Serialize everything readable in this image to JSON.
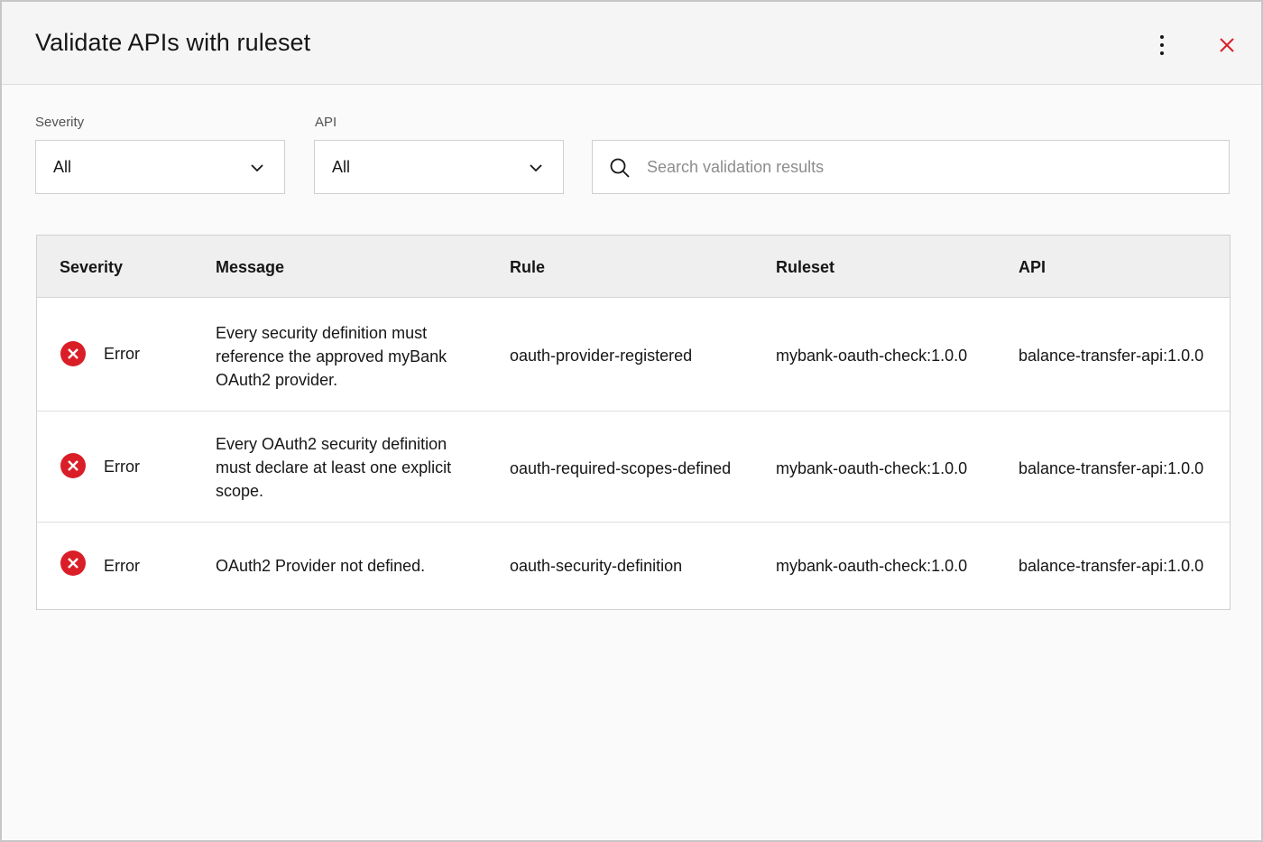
{
  "modal": {
    "title": "Validate APIs with ruleset",
    "close_color": "#da1e28"
  },
  "filters": {
    "severity": {
      "label": "Severity",
      "value": "All"
    },
    "api": {
      "label": "API",
      "value": "All"
    },
    "search": {
      "placeholder": "Search validation results",
      "value": ""
    }
  },
  "table": {
    "columns": [
      "Severity",
      "Message",
      "Rule",
      "Ruleset",
      "API"
    ],
    "rows": [
      {
        "severity": "Error",
        "icon": "error-filled-icon",
        "message": "Every security definition must reference the approved myBank OAuth2 provider.",
        "rule": "oauth-provider-registered",
        "ruleset": "mybank-oauth-check:1.0.0",
        "api": "balance-transfer-api:1.0.0"
      },
      {
        "severity": "Error",
        "icon": "error-filled-icon",
        "message": "Every OAuth2 security definition must declare at least one explicit scope.",
        "rule": "oauth-required-scopes-defined",
        "ruleset": "mybank-oauth-check:1.0.0",
        "api": "balance-transfer-api:1.0.0"
      },
      {
        "severity": "Error",
        "icon": "error-filled-icon",
        "message": "OAuth2 Provider not defined.",
        "rule": "oauth-security-definition",
        "ruleset": "mybank-oauth-check:1.0.0",
        "api": "balance-transfer-api:1.0.0"
      }
    ]
  },
  "colors": {
    "error": "#da1e28",
    "header_bg": "#efefef"
  }
}
